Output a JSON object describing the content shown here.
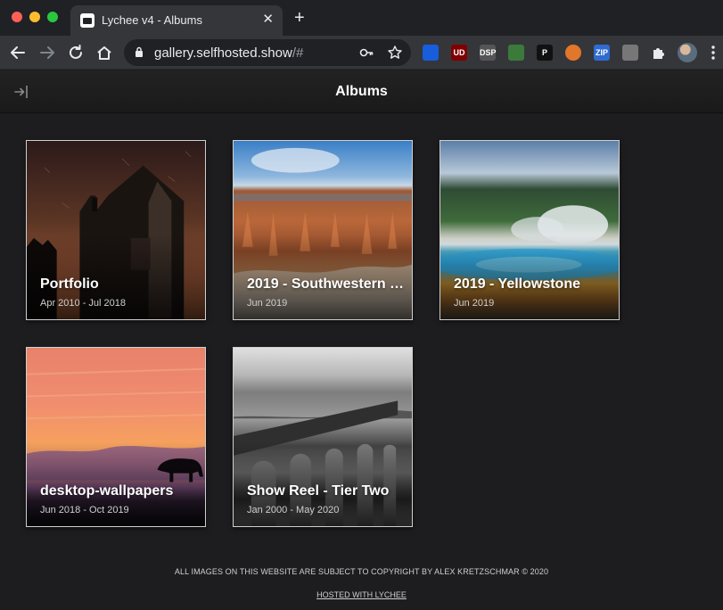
{
  "browser": {
    "tab_title": "Lychee v4 - Albums",
    "tab_close": "✕",
    "new_tab": "+",
    "url_host": "gallery.selfhosted.show",
    "url_path": "/#",
    "extensions": [
      {
        "name": "bitwarden",
        "label": "",
        "color": "#175ddc"
      },
      {
        "name": "ublock",
        "label": "UD",
        "color": "#800000"
      },
      {
        "name": "dsp",
        "label": "DSP",
        "color": "#555555"
      },
      {
        "name": "colorpicker",
        "label": "",
        "color": "#3b7a3b"
      },
      {
        "name": "pocket",
        "label": "P",
        "color": "#111111"
      },
      {
        "name": "owl",
        "label": "",
        "color": "#e2762b"
      },
      {
        "name": "zip",
        "label": "ZIP",
        "color": "#2f6bd0"
      },
      {
        "name": "sneaker",
        "label": "",
        "color": "#777777"
      }
    ]
  },
  "header": {
    "title": "Albums"
  },
  "albums": [
    {
      "title": "Portfolio",
      "date": "Apr 2010 - Jul 2018"
    },
    {
      "title": "2019 - Southwestern …",
      "date": "Jun 2019"
    },
    {
      "title": "2019 - Yellowstone",
      "date": "Jun 2019"
    },
    {
      "title": "desktop-wallpapers",
      "date": "Jun 2018 - Oct 2019"
    },
    {
      "title": "Show Reel - Tier Two",
      "date": "Jan 2000 - May 2020"
    }
  ],
  "footer": {
    "copyright": "ALL IMAGES ON THIS WEBSITE ARE SUBJECT TO COPYRIGHT BY ALEX KRETZSCHMAR © 2020",
    "hosted": "HOSTED WITH LYCHEE"
  },
  "colors": {
    "background": "#1d1d1f",
    "header": "#1a1a1a",
    "border": "#cfcfcf"
  }
}
